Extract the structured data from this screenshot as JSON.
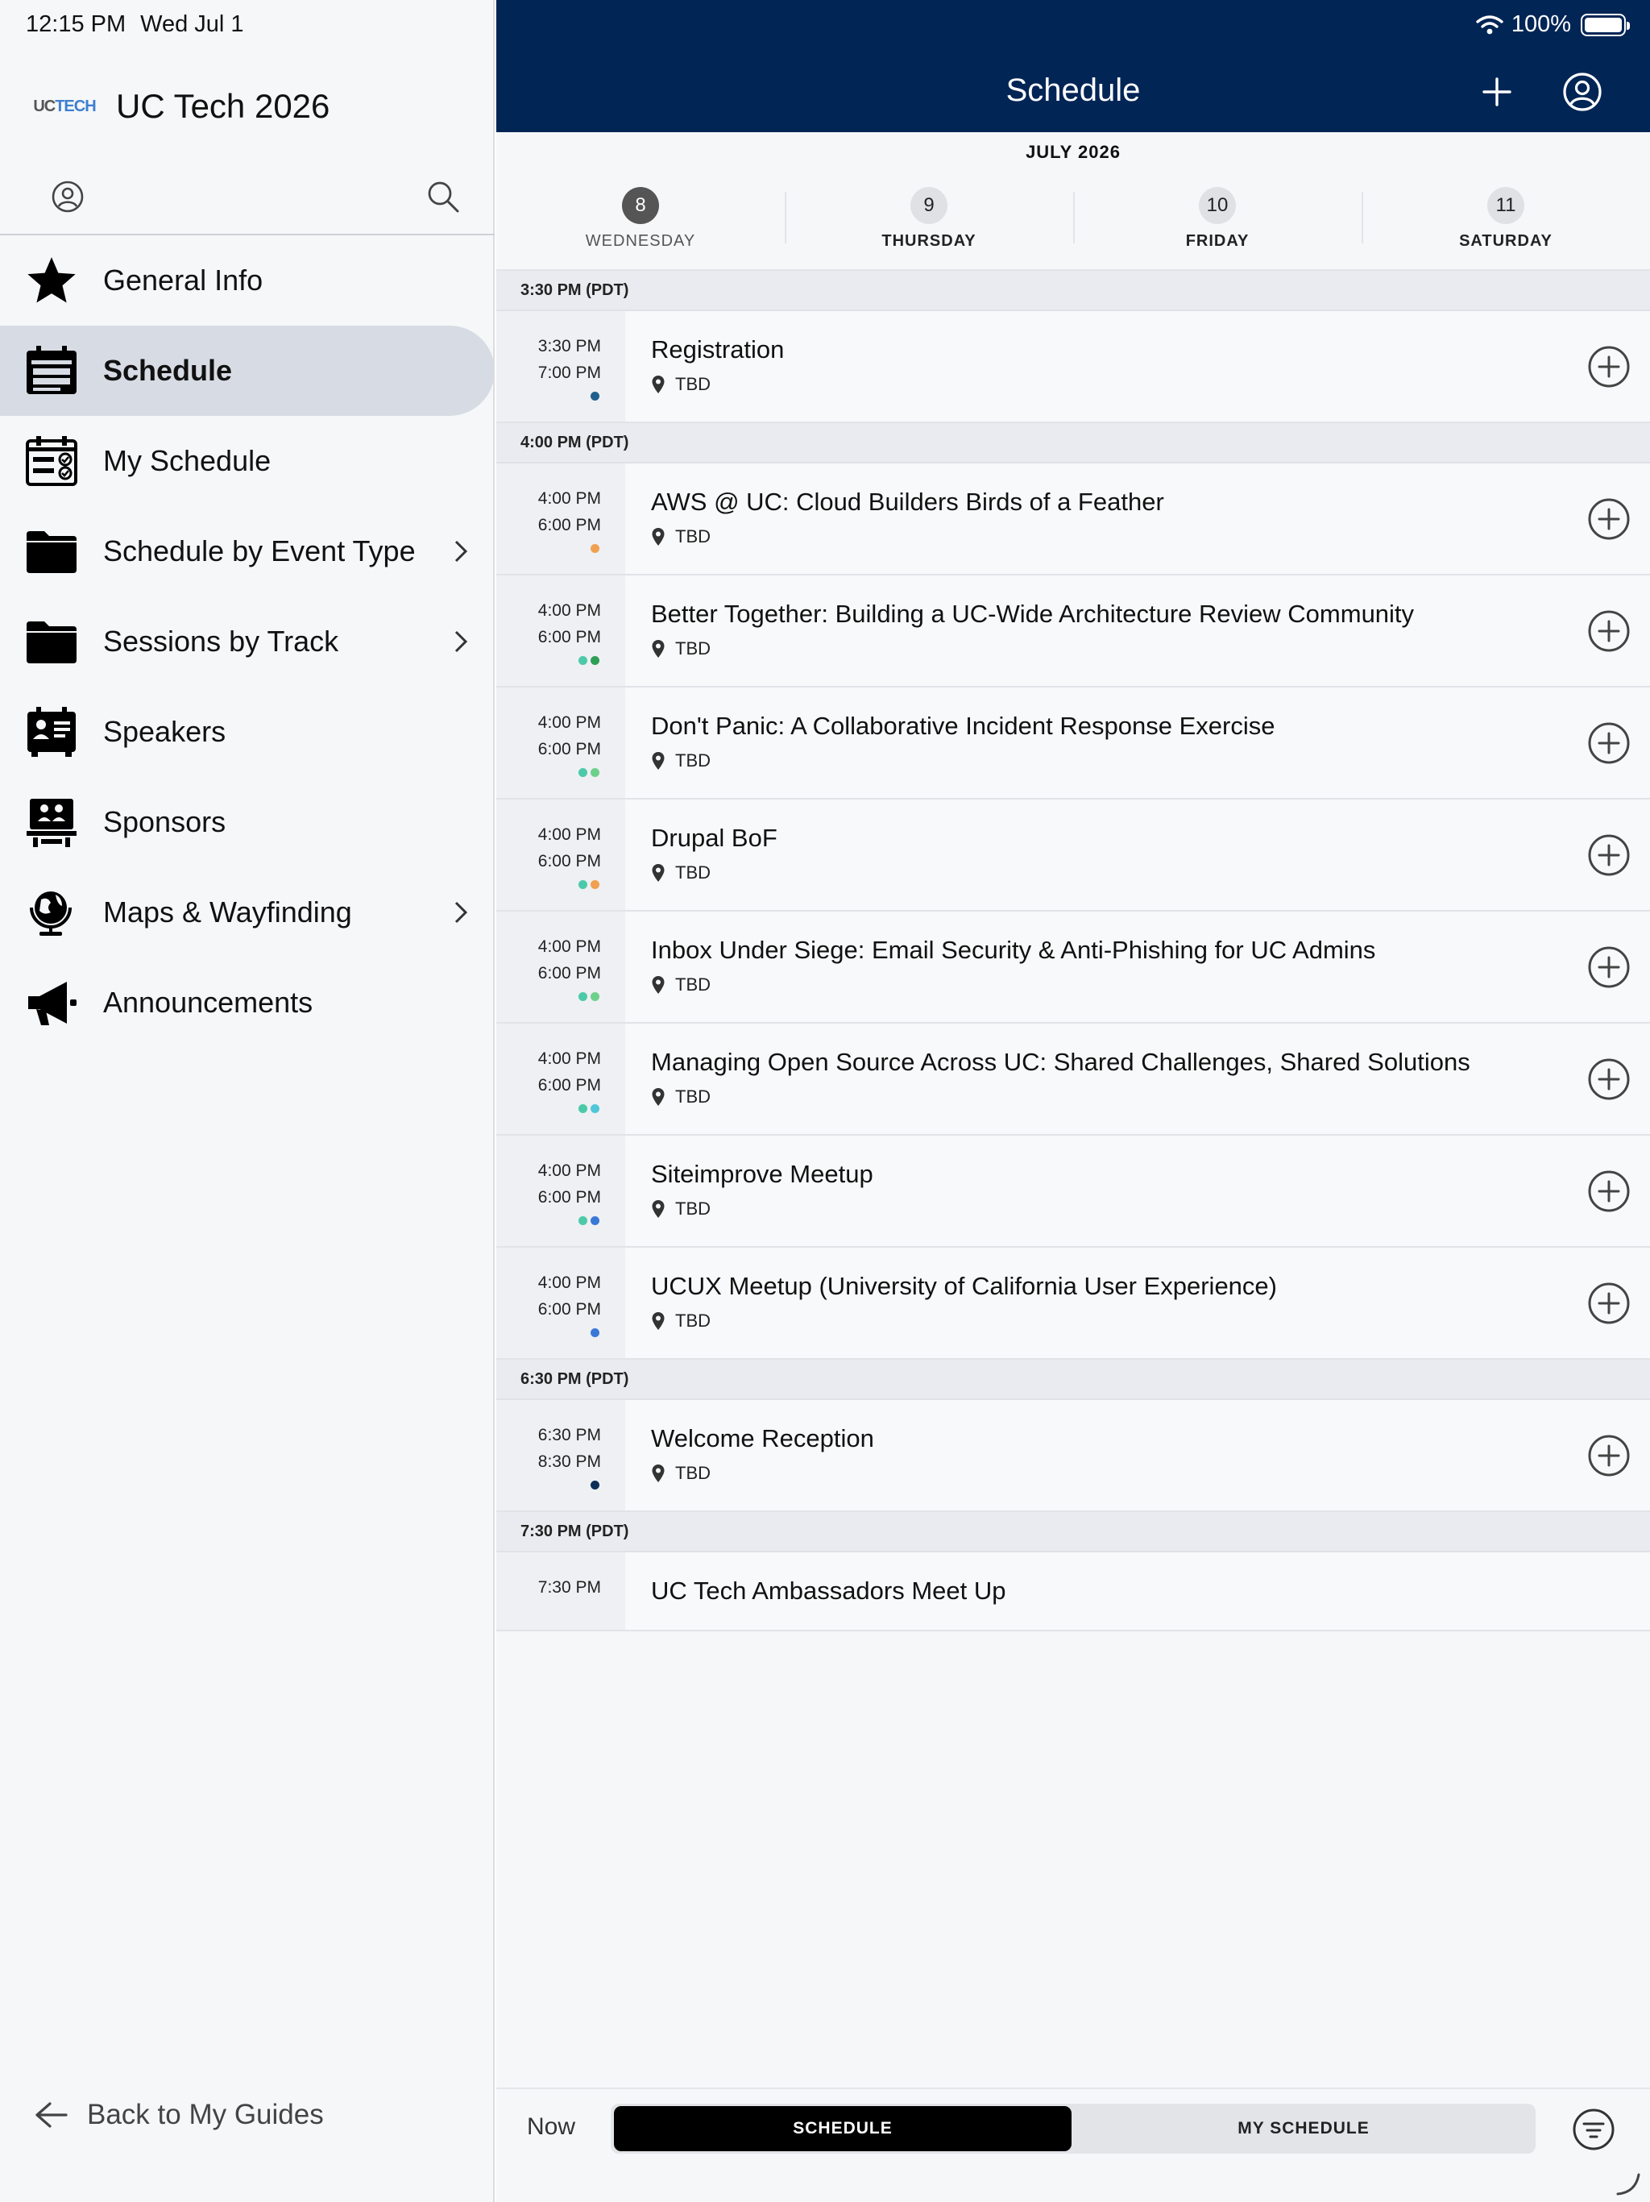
{
  "status_bar": {
    "time": "12:15 PM",
    "date": "Wed Jul 1",
    "battery": "100%"
  },
  "sidebar": {
    "app_logo_text": [
      "UC",
      "TECH"
    ],
    "app_title": "UC Tech 2026",
    "items": [
      {
        "label": "General Info",
        "icon": "star-icon",
        "chevron": false,
        "active": false
      },
      {
        "label": "Schedule",
        "icon": "schedule-icon",
        "chevron": false,
        "active": true
      },
      {
        "label": "My Schedule",
        "icon": "my-schedule-icon",
        "chevron": false,
        "active": false
      },
      {
        "label": "Schedule by Event Type",
        "icon": "folder-icon",
        "chevron": true,
        "active": false
      },
      {
        "label": "Sessions by Track",
        "icon": "folder-icon",
        "chevron": true,
        "active": false
      },
      {
        "label": "Speakers",
        "icon": "speakers-icon",
        "chevron": false,
        "active": false
      },
      {
        "label": "Sponsors",
        "icon": "sponsors-icon",
        "chevron": false,
        "active": false
      },
      {
        "label": "Maps & Wayfinding",
        "icon": "globe-icon",
        "chevron": true,
        "active": false
      },
      {
        "label": "Announcements",
        "icon": "megaphone-icon",
        "chevron": false,
        "active": false
      }
    ],
    "back_label": "Back to My Guides"
  },
  "header": {
    "title": "Schedule",
    "month": "JULY 2026"
  },
  "days": [
    {
      "num": "8",
      "name": "WEDNESDAY",
      "active": true
    },
    {
      "num": "9",
      "name": "THURSDAY",
      "active": false
    },
    {
      "num": "10",
      "name": "FRIDAY",
      "active": false
    },
    {
      "num": "11",
      "name": "SATURDAY",
      "active": false
    }
  ],
  "slots": [
    {
      "label": "3:30 PM (PDT)",
      "sessions": [
        {
          "start": "3:30 PM",
          "end": "7:00 PM",
          "title": "Registration",
          "location": "TBD",
          "dots": [
            "#1f5f8b"
          ]
        }
      ]
    },
    {
      "label": "4:00 PM (PDT)",
      "sessions": [
        {
          "start": "4:00 PM",
          "end": "6:00 PM",
          "title": "AWS @ UC: Cloud Builders Birds of a Feather",
          "location": "TBD",
          "dots": [
            "#f0a050"
          ]
        },
        {
          "start": "4:00 PM",
          "end": "6:00 PM",
          "title": "Better Together: Building a UC-Wide Architecture Review Community",
          "location": "TBD",
          "dots": [
            "#4cc9a8",
            "#2f9e55"
          ]
        },
        {
          "start": "4:00 PM",
          "end": "6:00 PM",
          "title": "Don't Panic: A Collaborative Incident Response Exercise",
          "location": "TBD",
          "dots": [
            "#4cc9a8",
            "#6dd08a"
          ]
        },
        {
          "start": "4:00 PM",
          "end": "6:00 PM",
          "title": "Drupal BoF",
          "location": "TBD",
          "dots": [
            "#4cc9a8",
            "#f0a050"
          ]
        },
        {
          "start": "4:00 PM",
          "end": "6:00 PM",
          "title": "Inbox Under Siege: Email Security & Anti-Phishing for UC Admins",
          "location": "TBD",
          "dots": [
            "#4cc9a8",
            "#6dd08a"
          ]
        },
        {
          "start": "4:00 PM",
          "end": "6:00 PM",
          "title": "Managing Open Source Across UC: Shared Challenges, Shared Solutions",
          "location": "TBD",
          "dots": [
            "#4cc9a8",
            "#4fc6d9"
          ]
        },
        {
          "start": "4:00 PM",
          "end": "6:00 PM",
          "title": "Siteimprove Meetup",
          "location": "TBD",
          "dots": [
            "#4cc9a8",
            "#3a78d8"
          ]
        },
        {
          "start": "4:00 PM",
          "end": "6:00 PM",
          "title": "UCUX Meetup (University of California User Experience)",
          "location": "TBD",
          "dots": [
            "#3a78d8"
          ]
        }
      ]
    },
    {
      "label": "6:30 PM (PDT)",
      "sessions": [
        {
          "start": "6:30 PM",
          "end": "8:30 PM",
          "title": "Welcome Reception",
          "location": "TBD",
          "dots": [
            "#0e2e5a"
          ]
        }
      ]
    },
    {
      "label": "7:30 PM (PDT)",
      "sessions": [
        {
          "start": "7:30 PM",
          "end": "",
          "title": "UC Tech Ambassadors Meet Up",
          "location": "",
          "dots": []
        }
      ]
    }
  ],
  "bottom_bar": {
    "now_label": "Now",
    "schedule_label": "SCHEDULE",
    "my_schedule_label": "MY SCHEDULE"
  }
}
